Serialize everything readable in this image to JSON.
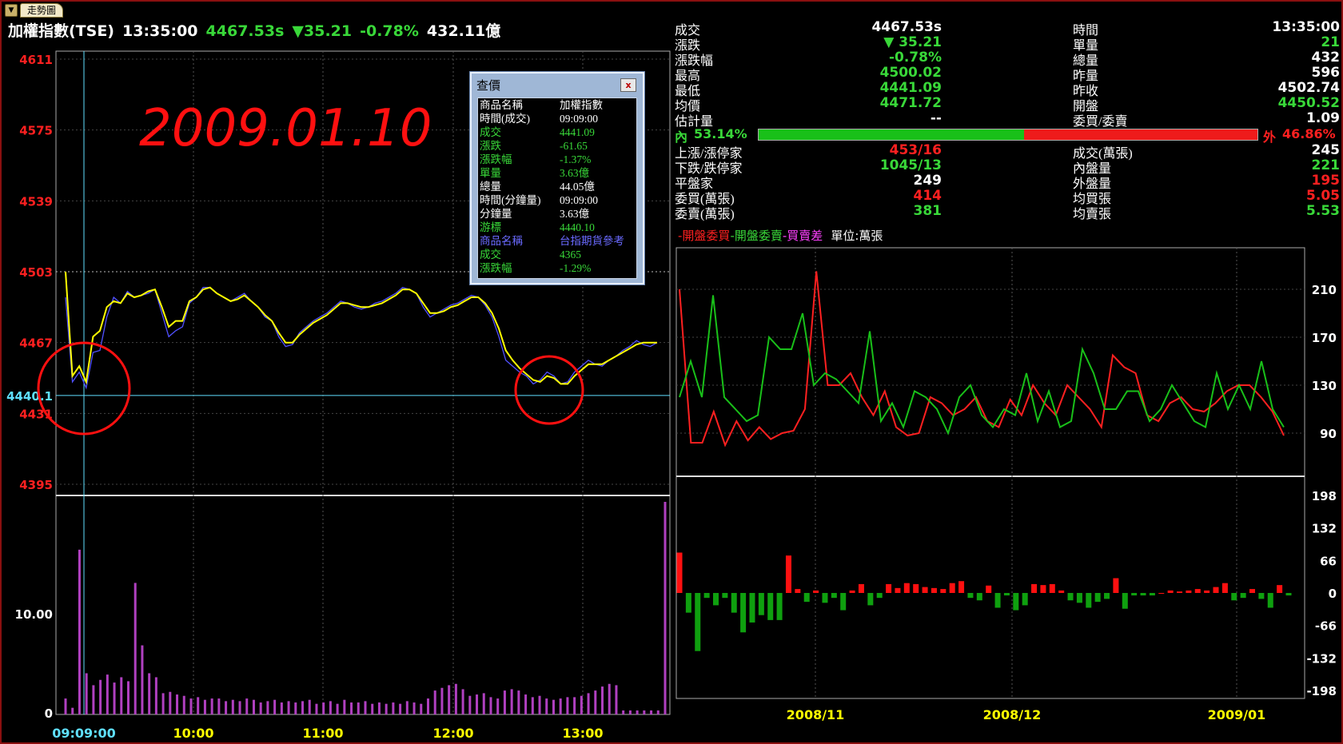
{
  "tab": {
    "label": "走勢圖"
  },
  "header": {
    "name": "加權指數(TSE)",
    "time": "13:35:00",
    "price": "4467.53s",
    "change": "▼35.21",
    "pct": "-0.78%",
    "volume": "432.11億"
  },
  "annotation": {
    "date_text": "2009.01.10"
  },
  "intraday": {
    "y_ticks": [
      "4611",
      "4575",
      "4539",
      "4503",
      "4467",
      "4431",
      "4395"
    ],
    "cursor_value": "4440.1",
    "volume_ticks": [
      "10.00",
      "0"
    ],
    "x_ticks": [
      "09:09:00",
      "10:00",
      "11:00",
      "12:00",
      "13:00"
    ],
    "prev_close": 4502.74,
    "cursor_time": "09:09:00",
    "index_color": "#5050ff",
    "avg_color": "#ffff00",
    "volume_color": "#b040c0"
  },
  "popup": {
    "title": "查價",
    "close_label": "x",
    "rows": [
      {
        "label": "商品名稱",
        "value": "加權指數",
        "lc": "#ffffff",
        "vc": "#ffffff"
      },
      {
        "label": "時間(成交)",
        "value": "09:09:00",
        "lc": "#ffffff",
        "vc": "#ffffff"
      },
      {
        "label": "成交",
        "value": "4441.09",
        "lc": "#39d839",
        "vc": "#39d839"
      },
      {
        "label": "漲跌",
        "value": "-61.65",
        "lc": "#39d839",
        "vc": "#39d839"
      },
      {
        "label": "漲跌幅",
        "value": "-1.37%",
        "lc": "#39d839",
        "vc": "#39d839"
      },
      {
        "label": "單量",
        "value": "3.63億",
        "lc": "#39d839",
        "vc": "#39d839"
      },
      {
        "label": "總量",
        "value": "44.05億",
        "lc": "#ffffff",
        "vc": "#ffffff"
      },
      {
        "label": "時間(分鐘量)",
        "value": "09:09:00",
        "lc": "#ffffff",
        "vc": "#ffffff"
      },
      {
        "label": "分鐘量",
        "value": "3.63億",
        "lc": "#ffffff",
        "vc": "#ffffff"
      },
      {
        "label": "游標",
        "value": "4440.10",
        "lc": "#39d839",
        "vc": "#39d839"
      },
      {
        "label": "商品名稱",
        "value": "台指期貨參考",
        "lc": "#6a6aff",
        "vc": "#6a6aff"
      },
      {
        "label": "成交",
        "value": "4365",
        "lc": "#39d839",
        "vc": "#39d839"
      },
      {
        "label": "漲跌幅",
        "value": "-1.29%",
        "lc": "#39d839",
        "vc": "#39d839"
      }
    ]
  },
  "quote": {
    "left": [
      {
        "label": "成交",
        "value": "4467.53s",
        "color": "#ffffff"
      },
      {
        "label": "漲跌",
        "value": "▼ 35.21",
        "color": "#39d839"
      },
      {
        "label": "漲跌幅",
        "value": "-0.78%",
        "color": "#39d839"
      },
      {
        "label": "最高",
        "value": "4500.02",
        "color": "#39d839"
      },
      {
        "label": "最低",
        "value": "4441.09",
        "color": "#39d839"
      },
      {
        "label": "均價",
        "value": "4471.72",
        "color": "#39d839"
      },
      {
        "label": "估計量",
        "value": "--",
        "color": "#ffffff"
      }
    ],
    "right": [
      {
        "label": "時間",
        "value": "13:35:00",
        "color": "#ffffff"
      },
      {
        "label": "單量",
        "value": "21",
        "color": "#39d839"
      },
      {
        "label": "總量",
        "value": "432",
        "color": "#ffffff"
      },
      {
        "label": "昨量",
        "value": "596",
        "color": "#ffffff"
      },
      {
        "label": "昨收",
        "value": "4502.74",
        "color": "#ffffff"
      },
      {
        "label": "開盤",
        "value": "4450.52",
        "color": "#39d839"
      },
      {
        "label": "委買/委賣",
        "value": "1.09",
        "color": "#ffffff"
      }
    ],
    "ratio": {
      "in_label": "內",
      "in_pct": "53.14%",
      "out_label": "外",
      "out_pct": "46.86%",
      "in_fraction": 0.5314
    },
    "left2": [
      {
        "label": "上漲/漲停家",
        "value": "453/16",
        "color": "#ff2020"
      },
      {
        "label": "下跌/跌停家",
        "value": "1045/13",
        "color": "#39d839"
      },
      {
        "label": "平盤家",
        "value": "249",
        "color": "#ffffff"
      },
      {
        "label": "委買(萬張)",
        "value": "414",
        "color": "#ff2020"
      },
      {
        "label": "委賣(萬張)",
        "value": "381",
        "color": "#39d839"
      }
    ],
    "right2": [
      {
        "label": "成交(萬張)",
        "value": "245",
        "color": "#ffffff"
      },
      {
        "label": "內盤量",
        "value": "221",
        "color": "#39d839"
      },
      {
        "label": "外盤量",
        "value": "195",
        "color": "#ff2020"
      },
      {
        "label": "均買張",
        "value": "5.05",
        "color": "#ff2020"
      },
      {
        "label": "均賣張",
        "value": "5.53",
        "color": "#39d839"
      }
    ]
  },
  "legend": {
    "items": [
      {
        "label": "開盤委買",
        "color": "#ff2020"
      },
      {
        "label": "開盤委賣",
        "color": "#39d839"
      },
      {
        "label": "買賣差",
        "color": "#ff40ff"
      }
    ],
    "unit": "單位:萬張"
  },
  "chart_data": [
    {
      "type": "line",
      "x_labels": [
        "09:09:00",
        "10:00",
        "11:00",
        "12:00",
        "13:00"
      ],
      "y_ticks": [
        4611,
        4575,
        4539,
        4503,
        4467,
        4431,
        4395
      ],
      "ylim": [
        4395,
        4611
      ],
      "series": [
        {
          "values": [
            4490,
            4447,
            4452,
            4444,
            4462,
            4463,
            4480,
            4490,
            4487,
            4493,
            4490,
            4491,
            4492,
            4494,
            4482,
            4470,
            4473,
            4475,
            4487,
            4490,
            4495,
            4495,
            4492,
            4490,
            4488,
            4490,
            4492,
            4488,
            4485,
            4480,
            4478,
            4470,
            4465,
            4466,
            4472,
            4475,
            4478,
            4480,
            4482,
            4485,
            4488,
            4487,
            4485,
            4484,
            4485,
            4487,
            4488,
            4490,
            4492,
            4495,
            4494,
            4492,
            4485,
            4480,
            4482,
            4484,
            4486,
            4487,
            4489,
            4491,
            4490,
            4486,
            4480,
            4470,
            4458,
            4455,
            4452,
            4450,
            4446,
            4448,
            4452,
            4450,
            4446,
            4447,
            4452,
            4455,
            4458,
            4456,
            4455,
            4458,
            4460,
            4463,
            4465,
            4468,
            4466,
            4465,
            4467
          ]
        },
        {
          "values": [
            4503,
            4450,
            4455,
            4447,
            4470,
            4473,
            4485,
            4488,
            4487,
            4492,
            4490,
            4491,
            4493,
            4494,
            4485,
            4475,
            4478,
            4478,
            4488,
            4490,
            4494,
            4495,
            4492,
            4490,
            4488,
            4489,
            4491,
            4488,
            4485,
            4481,
            4478,
            4472,
            4467,
            4467,
            4471,
            4474,
            4477,
            4479,
            4481,
            4484,
            4487,
            4487,
            4486,
            4485,
            4485,
            4486,
            4487,
            4489,
            4491,
            4494,
            4494,
            4492,
            4487,
            4482,
            4482,
            4483,
            4485,
            4486,
            4488,
            4490,
            4490,
            4487,
            4482,
            4474,
            4463,
            4458,
            4454,
            4451,
            4448,
            4447,
            4450,
            4449,
            4446,
            4446,
            4450,
            4453,
            4456,
            4456,
            4456,
            4458,
            4460,
            4462,
            4464,
            4466,
            4467,
            4467,
            4467
          ]
        }
      ]
    },
    {
      "type": "bar",
      "yticks": [
        "10.00",
        "0"
      ],
      "values": [
        1.2,
        0.5,
        12.4,
        3.1,
        2.2,
        2.6,
        3.0,
        2.4,
        2.8,
        2.5,
        9.9,
        5.2,
        3.1,
        2.8,
        1.6,
        1.7,
        1.5,
        1.4,
        1.2,
        1.3,
        1.1,
        1.2,
        1.2,
        1.0,
        1.1,
        1.0,
        1.2,
        1.1,
        0.9,
        1.0,
        1.1,
        0.9,
        1.0,
        0.9,
        1.0,
        1.1,
        0.8,
        0.9,
        1.0,
        0.8,
        1.1,
        0.9,
        0.9,
        1.0,
        0.8,
        0.9,
        0.8,
        0.9,
        0.8,
        1.0,
        0.9,
        0.8,
        1.2,
        1.8,
        2.0,
        2.2,
        2.3,
        1.9,
        1.4,
        1.5,
        1.6,
        1.3,
        1.2,
        1.8,
        1.9,
        1.8,
        1.5,
        1.3,
        1.4,
        1.2,
        1.1,
        1.2,
        1.3,
        1.3,
        1.4,
        1.6,
        1.8,
        2.1,
        2.3,
        2.2,
        0.3,
        0.3,
        0.3,
        0.3,
        0.3,
        0.3,
        20.9
      ],
      "ylim": [
        0,
        16
      ]
    },
    {
      "type": "line",
      "x_labels": [
        "2008/11",
        "2008/12",
        "2009/01"
      ],
      "y_ticks": [
        210,
        170,
        130,
        90
      ],
      "ylim": [
        70,
        230
      ],
      "series": [
        {
          "values": [
            210,
            82,
            82,
            108,
            80,
            100,
            84,
            95,
            85,
            90,
            92,
            110,
            225,
            130,
            130,
            140,
            120,
            105,
            125,
            95,
            88,
            90,
            120,
            115,
            105,
            110,
            120,
            100,
            95,
            118,
            105,
            130,
            115,
            105,
            130,
            120,
            110,
            95,
            155,
            145,
            140,
            105,
            100,
            115,
            120,
            110,
            108,
            115,
            125,
            130,
            130,
            120,
            108,
            88
          ]
        },
        {
          "values": [
            120,
            150,
            120,
            205,
            120,
            110,
            100,
            105,
            170,
            160,
            160,
            190,
            130,
            140,
            135,
            125,
            115,
            175,
            100,
            115,
            95,
            125,
            120,
            110,
            90,
            120,
            130,
            105,
            95,
            110,
            105,
            140,
            100,
            125,
            95,
            100,
            160,
            140,
            110,
            110,
            125,
            125,
            100,
            110,
            130,
            115,
            100,
            95,
            140,
            110,
            130,
            110,
            150,
            110,
            95
          ]
        }
      ]
    },
    {
      "type": "bar",
      "yticks": [
        "198",
        "132",
        "66",
        "0",
        "-66",
        "-132",
        "-198"
      ],
      "values": [
        82,
        -40,
        -118,
        -10,
        -25,
        -10,
        -40,
        -80,
        -60,
        -45,
        -55,
        -55,
        76,
        8,
        -18,
        5,
        -20,
        -10,
        -35,
        5,
        18,
        -25,
        -10,
        18,
        10,
        20,
        18,
        12,
        10,
        8,
        20,
        24,
        -10,
        -15,
        15,
        -30,
        -5,
        -35,
        -25,
        18,
        16,
        18,
        5,
        -15,
        -20,
        -30,
        -18,
        -12,
        30,
        -32,
        -5,
        -5,
        -5,
        0,
        5,
        3,
        5,
        8,
        5,
        12,
        20,
        -15,
        -10,
        8,
        -12,
        -30,
        16,
        -5
      ],
      "ylim": [
        -198,
        198
      ]
    }
  ]
}
